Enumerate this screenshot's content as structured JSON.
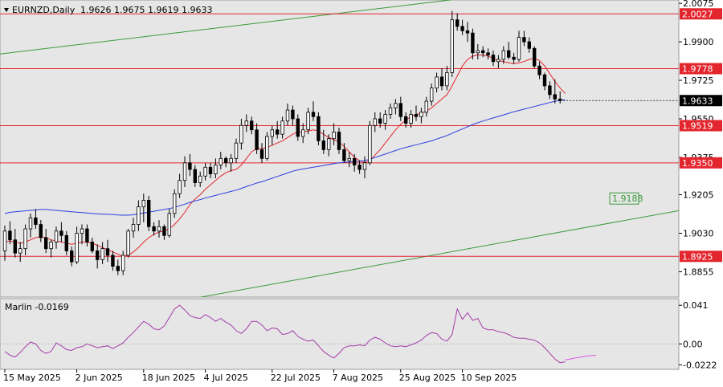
{
  "chart_data": [
    {
      "type": "candlestick",
      "header": {
        "symbol": "EURNZD,Daily",
        "ohlc": "1.9626 1.9675 1.9619 1.9633"
      },
      "y_axis": {
        "range": [
          1.874,
          2.009
        ],
        "ticks": [
          "2.0075",
          "1.9900",
          "1.9725",
          "1.9550",
          "1.9375",
          "1.9205",
          "1.9030",
          "1.8855"
        ]
      },
      "price_tag": {
        "value": "1.9633"
      },
      "levels": [
        {
          "value": 2.0027,
          "label": "2.0027",
          "color": "#e3262e"
        },
        {
          "value": 1.9778,
          "label": "1.9778",
          "color": "#e3262e"
        },
        {
          "value": 1.9519,
          "label": "1.9519",
          "color": "#e3262e"
        },
        {
          "value": 1.935,
          "label": "1.9350",
          "color": "#e3262e"
        },
        {
          "value": 1.8925,
          "label": "1.8925",
          "color": "#e3262e"
        }
      ],
      "channel": {
        "color": "#3a9a3a",
        "upper": [
          [
            1,
            1.985
          ],
          [
            93,
            2.0108
          ]
        ],
        "lower": [
          [
            50,
            1.879
          ],
          [
            160,
            1.9255
          ]
        ],
        "label": {
          "text": "1.9188",
          "value": 1.9188
        }
      },
      "candles": [
        [
          1.895,
          1.9065,
          1.8905,
          1.904
        ],
        [
          1.904,
          1.9085,
          1.898,
          1.9
        ],
        [
          1.9,
          1.905,
          1.892,
          1.894
        ],
        [
          1.894,
          1.899,
          1.89,
          1.896
        ],
        [
          1.896,
          1.907,
          1.893,
          1.905
        ],
        [
          1.905,
          1.912,
          1.901,
          1.91
        ],
        [
          1.91,
          1.914,
          1.905,
          1.907
        ],
        [
          1.907,
          1.909,
          1.899,
          1.901
        ],
        [
          1.901,
          1.905,
          1.894,
          1.896
        ],
        [
          1.896,
          1.9,
          1.892,
          1.899
        ],
        [
          1.899,
          1.906,
          1.896,
          1.904
        ],
        [
          1.904,
          1.908,
          1.899,
          1.902
        ],
        [
          1.902,
          1.904,
          1.893,
          1.895
        ],
        [
          1.895,
          1.897,
          1.888,
          1.89
        ],
        [
          1.89,
          1.906,
          1.889,
          1.903
        ],
        [
          1.903,
          1.907,
          1.898,
          1.905
        ],
        [
          1.905,
          1.907,
          1.897,
          1.899
        ],
        [
          1.899,
          1.901,
          1.894,
          1.895
        ],
        [
          1.895,
          1.898,
          1.887,
          1.891
        ],
        [
          1.891,
          1.899,
          1.889,
          1.896
        ],
        [
          1.896,
          1.9,
          1.89,
          1.893
        ],
        [
          1.893,
          1.895,
          1.886,
          1.888
        ],
        [
          1.888,
          1.891,
          1.884,
          1.886
        ],
        [
          1.886,
          1.895,
          1.884,
          1.893
        ],
        [
          1.893,
          1.905,
          1.892,
          1.904
        ],
        [
          1.904,
          1.91,
          1.901,
          1.907
        ],
        [
          1.907,
          1.918,
          1.904,
          1.915
        ],
        [
          1.915,
          1.921,
          1.908,
          1.918
        ],
        [
          1.918,
          1.92,
          1.904,
          1.906
        ],
        [
          1.906,
          1.908,
          1.902,
          1.904
        ],
        [
          1.904,
          1.909,
          1.901,
          1.906
        ],
        [
          1.906,
          1.907,
          1.9,
          1.902
        ],
        [
          1.902,
          1.914,
          1.901,
          1.912
        ],
        [
          1.912,
          1.923,
          1.91,
          1.921
        ],
        [
          1.921,
          1.93,
          1.919,
          1.927
        ],
        [
          1.927,
          1.938,
          1.924,
          1.935
        ],
        [
          1.935,
          1.939,
          1.929,
          1.932
        ],
        [
          1.932,
          1.934,
          1.924,
          1.926
        ],
        [
          1.926,
          1.931,
          1.924,
          1.929
        ],
        [
          1.929,
          1.935,
          1.927,
          1.933
        ],
        [
          1.933,
          1.935,
          1.928,
          1.93
        ],
        [
          1.93,
          1.937,
          1.928,
          1.934
        ],
        [
          1.934,
          1.94,
          1.932,
          1.937
        ],
        [
          1.937,
          1.938,
          1.933,
          1.935
        ],
        [
          1.935,
          1.939,
          1.931,
          1.937
        ],
        [
          1.937,
          1.946,
          1.935,
          1.944
        ],
        [
          1.944,
          1.955,
          1.941,
          1.952
        ],
        [
          1.952,
          1.957,
          1.949,
          1.954
        ],
        [
          1.954,
          1.956,
          1.948,
          1.95
        ],
        [
          1.95,
          1.953,
          1.939,
          1.941
        ],
        [
          1.941,
          1.944,
          1.935,
          1.937
        ],
        [
          1.937,
          1.949,
          1.936,
          1.947
        ],
        [
          1.947,
          1.952,
          1.943,
          1.95
        ],
        [
          1.95,
          1.954,
          1.946,
          1.948
        ],
        [
          1.948,
          1.956,
          1.946,
          1.954
        ],
        [
          1.954,
          1.962,
          1.952,
          1.959
        ],
        [
          1.959,
          1.961,
          1.952,
          1.955
        ],
        [
          1.955,
          1.957,
          1.945,
          1.947
        ],
        [
          1.947,
          1.953,
          1.944,
          1.95
        ],
        [
          1.95,
          1.96,
          1.948,
          1.958
        ],
        [
          1.958,
          1.963,
          1.954,
          1.956
        ],
        [
          1.956,
          1.958,
          1.943,
          1.945
        ],
        [
          1.945,
          1.95,
          1.939,
          1.941
        ],
        [
          1.941,
          1.948,
          1.938,
          1.946
        ],
        [
          1.946,
          1.953,
          1.943,
          1.949
        ],
        [
          1.949,
          1.951,
          1.939,
          1.941
        ],
        [
          1.941,
          1.944,
          1.935,
          1.936
        ],
        [
          1.936,
          1.94,
          1.933,
          1.937
        ],
        [
          1.937,
          1.939,
          1.931,
          1.934
        ],
        [
          1.934,
          1.936,
          1.93,
          1.932
        ],
        [
          1.932,
          1.938,
          1.928,
          1.935
        ],
        [
          1.935,
          1.954,
          1.934,
          1.952
        ],
        [
          1.952,
          1.958,
          1.949,
          1.955
        ],
        [
          1.955,
          1.958,
          1.951,
          1.953
        ],
        [
          1.953,
          1.959,
          1.95,
          1.957
        ],
        [
          1.957,
          1.962,
          1.955,
          1.96
        ],
        [
          1.96,
          1.964,
          1.957,
          1.962
        ],
        [
          1.962,
          1.965,
          1.954,
          1.956
        ],
        [
          1.956,
          1.958,
          1.951,
          1.953
        ],
        [
          1.953,
          1.959,
          1.951,
          1.957
        ],
        [
          1.957,
          1.961,
          1.954,
          1.956
        ],
        [
          1.956,
          1.96,
          1.953,
          1.958
        ],
        [
          1.958,
          1.965,
          1.956,
          1.963
        ],
        [
          1.963,
          1.971,
          1.961,
          1.969
        ],
        [
          1.969,
          1.976,
          1.967,
          1.974
        ],
        [
          1.974,
          1.978,
          1.968,
          1.97
        ],
        [
          1.97,
          1.979,
          1.968,
          1.976
        ],
        [
          1.976,
          2.004,
          1.974,
          2.0
        ],
        [
          2.0,
          2.003,
          1.995,
          1.997
        ],
        [
          1.997,
          2.0,
          1.993,
          1.995
        ],
        [
          1.995,
          1.999,
          1.99,
          1.994
        ],
        [
          1.994,
          1.996,
          1.982,
          1.985
        ],
        [
          1.985,
          1.989,
          1.982,
          1.986
        ],
        [
          1.986,
          1.988,
          1.983,
          1.985
        ],
        [
          1.985,
          1.987,
          1.982,
          1.984
        ],
        [
          1.984,
          1.986,
          1.979,
          1.981
        ],
        [
          1.981,
          1.984,
          1.978,
          1.982
        ],
        [
          1.982,
          1.988,
          1.98,
          1.986
        ],
        [
          1.986,
          1.99,
          1.982,
          1.983
        ],
        [
          1.983,
          1.985,
          1.98,
          1.982
        ],
        [
          1.982,
          1.995,
          1.981,
          1.992
        ],
        [
          1.992,
          1.995,
          1.988,
          1.99
        ],
        [
          1.99,
          1.992,
          1.985,
          1.987
        ],
        [
          1.987,
          1.988,
          1.978,
          1.979
        ],
        [
          1.979,
          1.981,
          1.973,
          1.975
        ],
        [
          1.975,
          1.976,
          1.968,
          1.97
        ],
        [
          1.97,
          1.972,
          1.964,
          1.966
        ],
        [
          1.966,
          1.973,
          1.962,
          1.964
        ],
        [
          1.964,
          1.9675,
          1.9619,
          1.9633
        ]
      ],
      "series": [
        {
          "name": "ma-fast",
          "color": "#e3262e",
          "values": [
            1.899,
            1.8995,
            1.899,
            1.8985,
            1.899,
            1.9,
            1.901,
            1.9015,
            1.901,
            1.9,
            1.8995,
            1.899,
            1.8985,
            1.898,
            1.8985,
            1.899,
            1.899,
            1.8985,
            1.8975,
            1.8965,
            1.8955,
            1.8945,
            1.8935,
            1.8925,
            1.893,
            1.8945,
            1.8965,
            1.899,
            1.901,
            1.9025,
            1.9035,
            1.904,
            1.905,
            1.907,
            1.9095,
            1.9125,
            1.916,
            1.9185,
            1.9205,
            1.923,
            1.925,
            1.927,
            1.929,
            1.9305,
            1.9315,
            1.932,
            1.934,
            1.937,
            1.94,
            1.9415,
            1.9415,
            1.942,
            1.943,
            1.944,
            1.945,
            1.9465,
            1.948,
            1.949,
            1.949,
            1.9495,
            1.95,
            1.9495,
            1.948,
            1.9465,
            1.9455,
            1.9445,
            1.9425,
            1.94,
            1.9375,
            1.936,
            1.935,
            1.936,
            1.9385,
            1.941,
            1.944,
            1.947,
            1.95,
            1.9525,
            1.9545,
            1.956,
            1.957,
            1.9575,
            1.9585,
            1.96,
            1.962,
            1.964,
            1.966,
            1.97,
            1.9745,
            1.979,
            1.982,
            1.9835,
            1.984,
            1.984,
            1.9835,
            1.9825,
            1.9815,
            1.981,
            1.9805,
            1.98,
            1.9805,
            1.981,
            1.982,
            1.9825,
            1.9815,
            1.979,
            1.9755,
            1.972,
            1.969,
            1.9665
          ]
        },
        {
          "name": "ma-slow",
          "color": "#2a3ee0",
          "values": [
            1.912,
            1.9125,
            1.9128,
            1.913,
            1.9132,
            1.9134,
            1.9136,
            1.9138,
            1.9138,
            1.9136,
            1.9134,
            1.9132,
            1.913,
            1.9128,
            1.9126,
            1.9124,
            1.9122,
            1.912,
            1.9118,
            1.9117,
            1.9116,
            1.9115,
            1.9113,
            1.9112,
            1.9112,
            1.9114,
            1.9118,
            1.9122,
            1.9126,
            1.913,
            1.9134,
            1.9138,
            1.9142,
            1.9148,
            1.9155,
            1.9162,
            1.917,
            1.9177,
            1.9183,
            1.919,
            1.9196,
            1.9202,
            1.9208,
            1.9214,
            1.922,
            1.9226,
            1.9234,
            1.9242,
            1.925,
            1.9258,
            1.9264,
            1.9272,
            1.928,
            1.9288,
            1.9296,
            1.9304,
            1.9312,
            1.9318,
            1.9322,
            1.9326,
            1.933,
            1.9334,
            1.9338,
            1.9342,
            1.9346,
            1.935,
            1.9352,
            1.9354,
            1.9356,
            1.9358,
            1.936,
            1.9366,
            1.9374,
            1.9382,
            1.939,
            1.9398,
            1.9406,
            1.9414,
            1.942,
            1.9426,
            1.9432,
            1.9438,
            1.9444,
            1.945,
            1.9458,
            1.9466,
            1.9474,
            1.9484,
            1.9494,
            1.9504,
            1.9514,
            1.9524,
            1.9532,
            1.954,
            1.9547,
            1.9554,
            1.9561,
            1.9568,
            1.9575,
            1.9582,
            1.9588,
            1.9594,
            1.96,
            1.9606,
            1.9612,
            1.9618,
            1.9624,
            1.963,
            1.9634,
            1.9636
          ]
        }
      ],
      "x_axis": {
        "ticks": [
          {
            "label": "15 May 2025",
            "index": 0
          },
          {
            "label": "2 Jun 2025",
            "index": 14
          },
          {
            "label": "18 Jun 2025",
            "index": 27
          },
          {
            "label": "4 Jul 2025",
            "index": 39
          },
          {
            "label": "22 Jul 2025",
            "index": 52
          },
          {
            "label": "7 Aug 2025",
            "index": 64
          },
          {
            "label": "25 Aug 2025",
            "index": 77
          },
          {
            "label": "10 Sep 2025",
            "index": 89
          }
        ]
      }
    },
    {
      "type": "line",
      "indicator": {
        "name": "Marlin",
        "value": "-0.0169"
      },
      "y_axis": {
        "range": [
          -0.027,
          0.048
        ],
        "ticks": [
          "0.041",
          "0.00",
          "-0.0222"
        ],
        "zero_line": 0
      },
      "series": [
        {
          "name": "Marlin",
          "color": "#a43ca8",
          "values": [
            -0.008,
            -0.012,
            -0.014,
            -0.009,
            -0.003,
            0.002,
            0.0,
            -0.007,
            -0.01,
            -0.008,
            0.001,
            -0.002,
            -0.006,
            -0.007,
            -0.004,
            -0.003,
            0.0,
            -0.002,
            -0.004,
            -0.003,
            -0.002,
            -0.005,
            -0.002,
            0.001,
            0.007,
            0.012,
            0.018,
            0.024,
            0.021,
            0.016,
            0.015,
            0.019,
            0.028,
            0.037,
            0.041,
            0.036,
            0.03,
            0.028,
            0.027,
            0.031,
            0.028,
            0.024,
            0.027,
            0.023,
            0.02,
            0.014,
            0.011,
            0.016,
            0.024,
            0.024,
            0.02,
            0.014,
            0.017,
            0.016,
            0.01,
            0.011,
            0.014,
            0.008,
            0.005,
            0.003,
            0.004,
            -0.002,
            -0.008,
            -0.012,
            -0.015,
            -0.01,
            -0.004,
            -0.002,
            -0.002,
            -0.001,
            -0.002,
            0.004,
            0.007,
            0.005,
            0.001,
            -0.002,
            -0.003,
            -0.002,
            -0.003,
            -0.001,
            0.001,
            0.004,
            0.009,
            0.012,
            0.011,
            0.005,
            0.003,
            0.01,
            0.037,
            0.026,
            0.033,
            0.025,
            0.027,
            0.017,
            0.015,
            0.015,
            0.013,
            0.012,
            0.01,
            0.007,
            0.006,
            0.006,
            0.005,
            0.004,
            0.001,
            -0.004,
            -0.01,
            -0.016,
            -0.02,
            -0.019
          ]
        },
        {
          "name": "Marlin-signal",
          "color": "#e056e6",
          "values_tail": [
            -0.017,
            -0.015,
            -0.013,
            -0.012
          ]
        }
      ]
    }
  ]
}
